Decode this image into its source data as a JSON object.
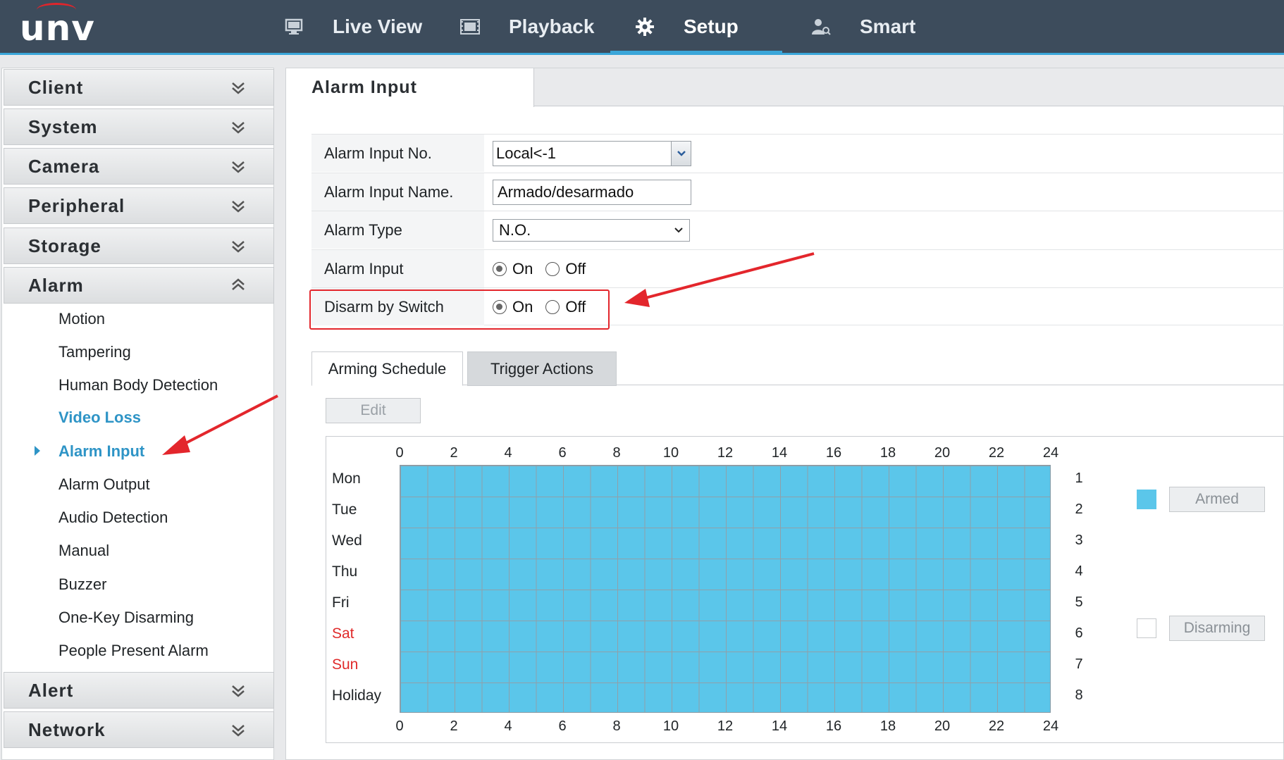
{
  "header": {
    "logo": "unv",
    "nav": [
      {
        "label": "Live View",
        "icon": "monitor-icon"
      },
      {
        "label": "Playback",
        "icon": "film-icon"
      },
      {
        "label": "Setup",
        "icon": "gear-icon",
        "active": true
      },
      {
        "label": "Smart",
        "icon": "person-search-icon"
      }
    ]
  },
  "sidebar": {
    "sections": [
      {
        "label": "Client",
        "expanded": false
      },
      {
        "label": "System",
        "expanded": false
      },
      {
        "label": "Camera",
        "expanded": false
      },
      {
        "label": "Peripheral",
        "expanded": false
      },
      {
        "label": "Storage",
        "expanded": false
      },
      {
        "label": "Alarm",
        "expanded": true
      },
      {
        "label": "Alert",
        "expanded": false
      },
      {
        "label": "Network",
        "expanded": false
      }
    ],
    "alarm_items": [
      "Motion",
      "Tampering",
      "Human Body Detection",
      "Video Loss",
      "Alarm Input",
      "Alarm Output",
      "Audio Detection",
      "Manual",
      "Buzzer",
      "One-Key Disarming",
      "People Present Alarm"
    ]
  },
  "page": {
    "title": "Alarm Input",
    "form": {
      "alarm_input_no": {
        "label": "Alarm Input No.",
        "value": "Local<-1"
      },
      "alarm_input_name": {
        "label": "Alarm Input Name.",
        "value": "Armado/desarmado"
      },
      "alarm_type": {
        "label": "Alarm Type",
        "value": "N.O."
      },
      "alarm_input": {
        "label": "Alarm Input",
        "on": "On",
        "off": "Off",
        "selected": "On"
      },
      "disarm_by_switch": {
        "label": "Disarm by Switch",
        "on": "On",
        "off": "Off",
        "selected": "On"
      }
    },
    "tabs": [
      "Arming Schedule",
      "Trigger Actions"
    ],
    "edit_label": "Edit",
    "schedule": {
      "hours": [
        "0",
        "2",
        "4",
        "6",
        "8",
        "10",
        "12",
        "14",
        "16",
        "18",
        "20",
        "22",
        "24"
      ],
      "days": [
        "Mon",
        "Tue",
        "Wed",
        "Thu",
        "Fri",
        "Sat",
        "Sun",
        "Holiday"
      ],
      "row_numbers": [
        "1",
        "2",
        "3",
        "4",
        "5",
        "6",
        "7",
        "8"
      ],
      "armed_label": "Armed",
      "disarming_label": "Disarming",
      "armed_color": "#5bc6ea",
      "weekend_color": "#e02a2a"
    }
  }
}
